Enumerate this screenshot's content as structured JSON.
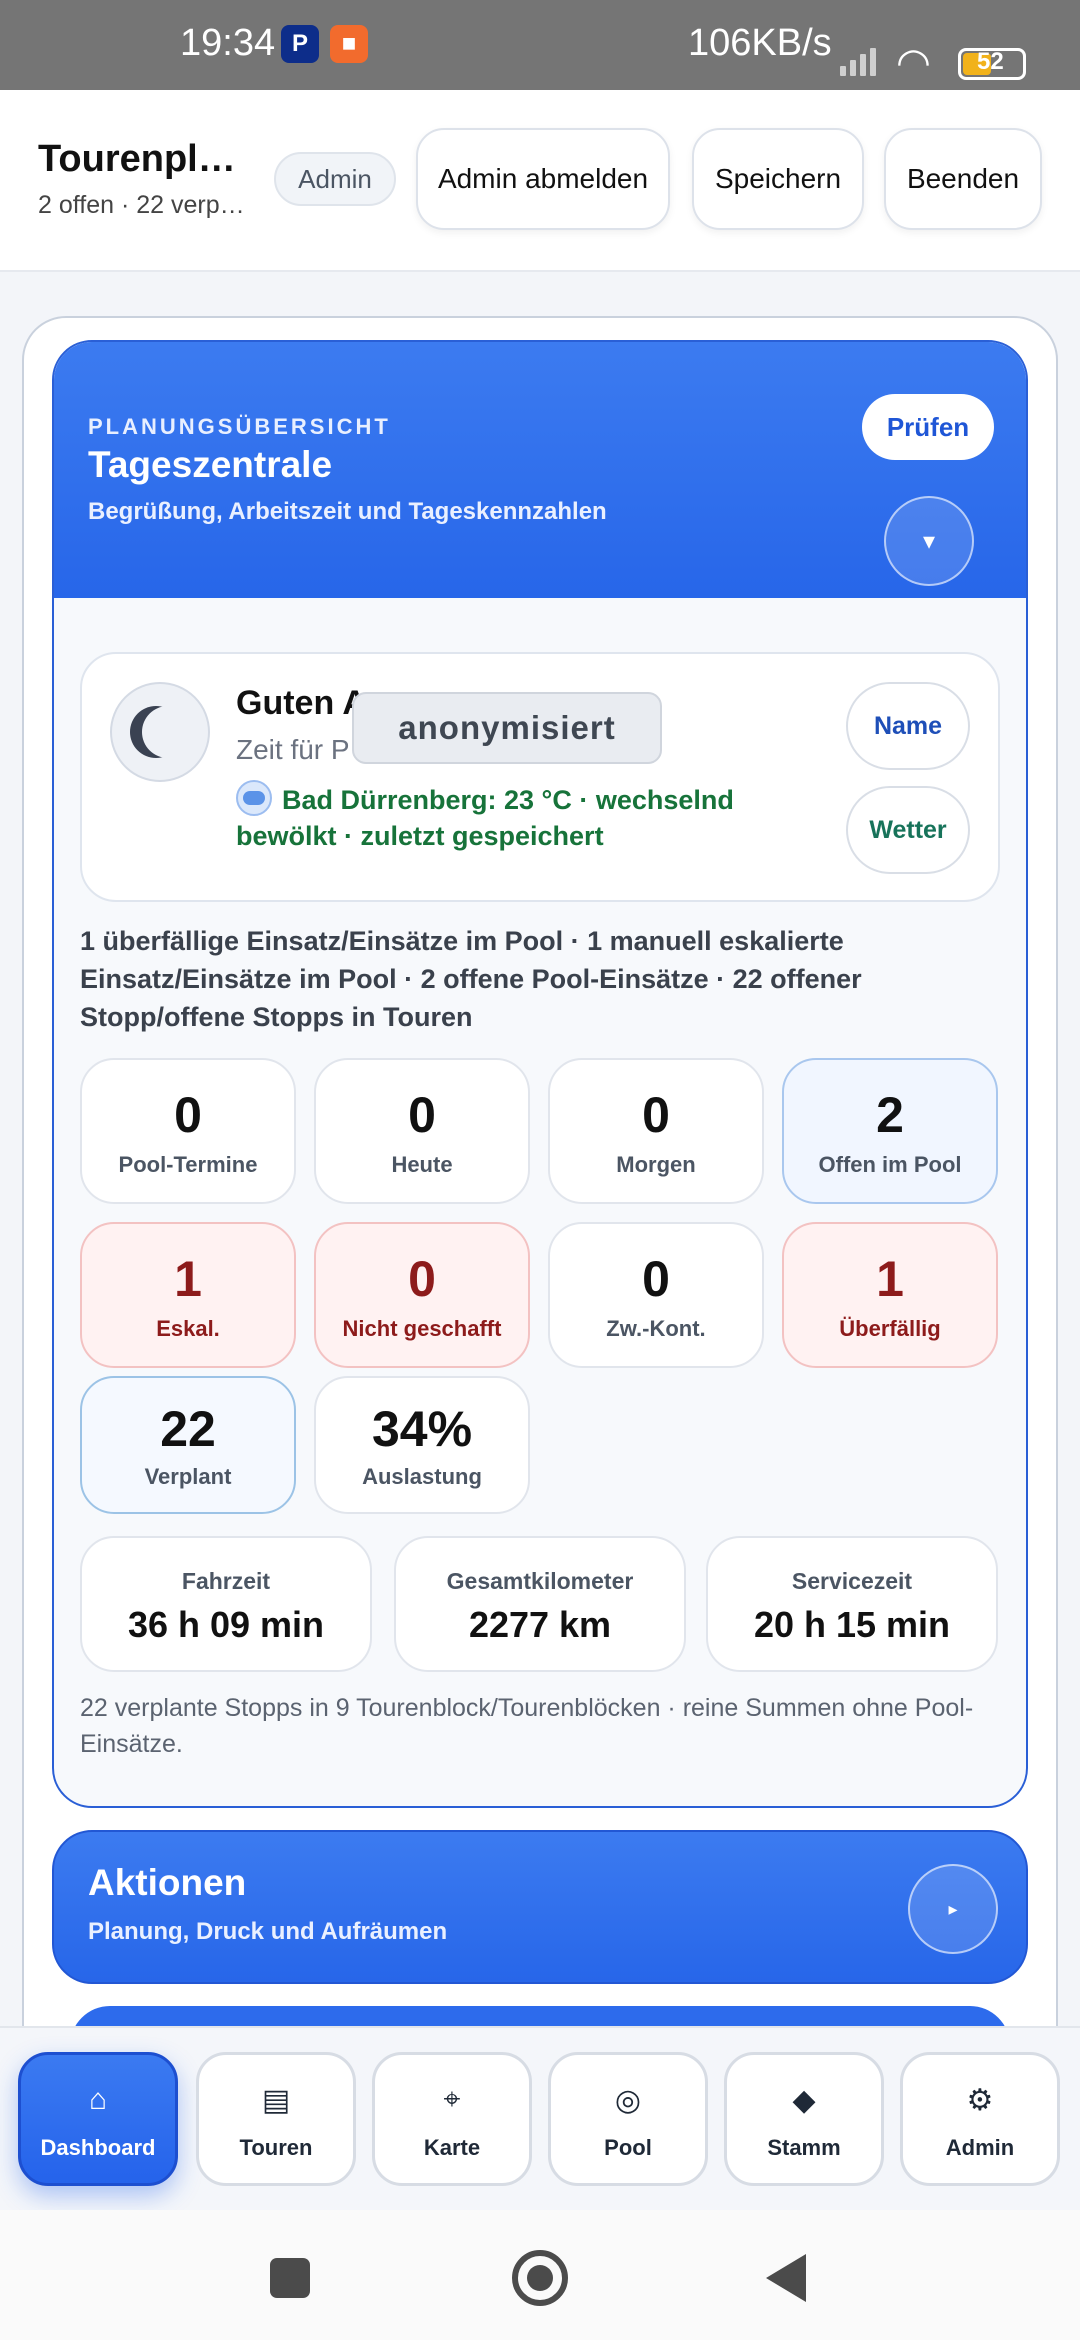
{
  "status_bar": {
    "time": "19:34",
    "net_speed": "106KB/s",
    "battery_level": "52",
    "icons": [
      "paypal-icon",
      "recorder-icon",
      "signal-icon",
      "wifi-icon",
      "battery-icon"
    ]
  },
  "header": {
    "title": "Tourenpl…",
    "subtitle": "2 offen · 22 verp…",
    "role_badge": "Admin",
    "buttons": {
      "logout": "Admin abmelden",
      "save": "Speichern",
      "exit": "Beenden"
    }
  },
  "dashboard": {
    "kicker": "PLANUNGSÜBERSICHT",
    "title": "Tageszentrale",
    "subtitle": "Begrüßung, Arbeitszeit und Tageskennzahlen",
    "check_button": "Prüfen",
    "collapse_icon": "▾",
    "greeting": {
      "title": "Guten A",
      "line": "Zeit für P",
      "anonymized": "anonymisiert",
      "weather": "Bad Dürrenberg: 23 °C · wechselnd bewölkt · zuletzt gespeichert",
      "name_button": "Name",
      "weather_button": "Wetter"
    },
    "summary": "1 überfällige Einsatz/Einsätze im Pool · 1 manuell eskalierte Einsatz/Einsätze im Pool · 2 offene Pool-Einsätze · 22 offener Stopp/offene Stopps in Touren",
    "kpis": [
      {
        "value": "0",
        "label": "Pool-Termine",
        "style": "neutral"
      },
      {
        "value": "0",
        "label": "Heute",
        "style": "neutral"
      },
      {
        "value": "0",
        "label": "Morgen",
        "style": "neutral"
      },
      {
        "value": "2",
        "label": "Offen im Pool",
        "style": "blue"
      },
      {
        "value": "1",
        "label": "Eskal.",
        "style": "red"
      },
      {
        "value": "0",
        "label": "Nicht geschafft",
        "style": "red"
      },
      {
        "value": "0",
        "label": "Zw.-Kont.",
        "style": "neutral"
      },
      {
        "value": "1",
        "label": "Überfällig",
        "style": "red"
      },
      {
        "value": "22",
        "label": "Verplant",
        "style": "blue"
      },
      {
        "value": "34%",
        "label": "Auslastung",
        "style": "neutral"
      }
    ],
    "totals": [
      {
        "label": "Fahrzeit",
        "value": "36 h 09 min"
      },
      {
        "label": "Gesamtkilometer",
        "value": "2277 km"
      },
      {
        "label": "Servicezeit",
        "value": "20 h 15 min"
      }
    ],
    "footnote": "22 verplante Stopps in 9 Tourenblock/Tourenblöcken · reine Summen ohne Pool-Einsätze."
  },
  "actions_section": {
    "title": "Aktionen",
    "subtitle": "Planung, Druck und Aufräumen",
    "expand_icon": "▸"
  },
  "bottom_nav": [
    {
      "label": "Dashboard",
      "icon": "⌂",
      "icon_name": "home-icon",
      "active": true
    },
    {
      "label": "Touren",
      "icon": "▤",
      "icon_name": "list-icon",
      "active": false
    },
    {
      "label": "Karte",
      "icon": "⌖",
      "icon_name": "map-target-icon",
      "active": false
    },
    {
      "label": "Pool",
      "icon": "◎",
      "icon_name": "pool-icon",
      "active": false
    },
    {
      "label": "Stamm",
      "icon": "◆",
      "icon_name": "diamond-icon",
      "active": false
    },
    {
      "label": "Admin",
      "icon": "⚙",
      "icon_name": "gear-icon",
      "active": false
    }
  ],
  "colors": {
    "accent_blue": "#2766e9",
    "danger_red": "#8d1b1b",
    "weather_green": "#17733a"
  }
}
